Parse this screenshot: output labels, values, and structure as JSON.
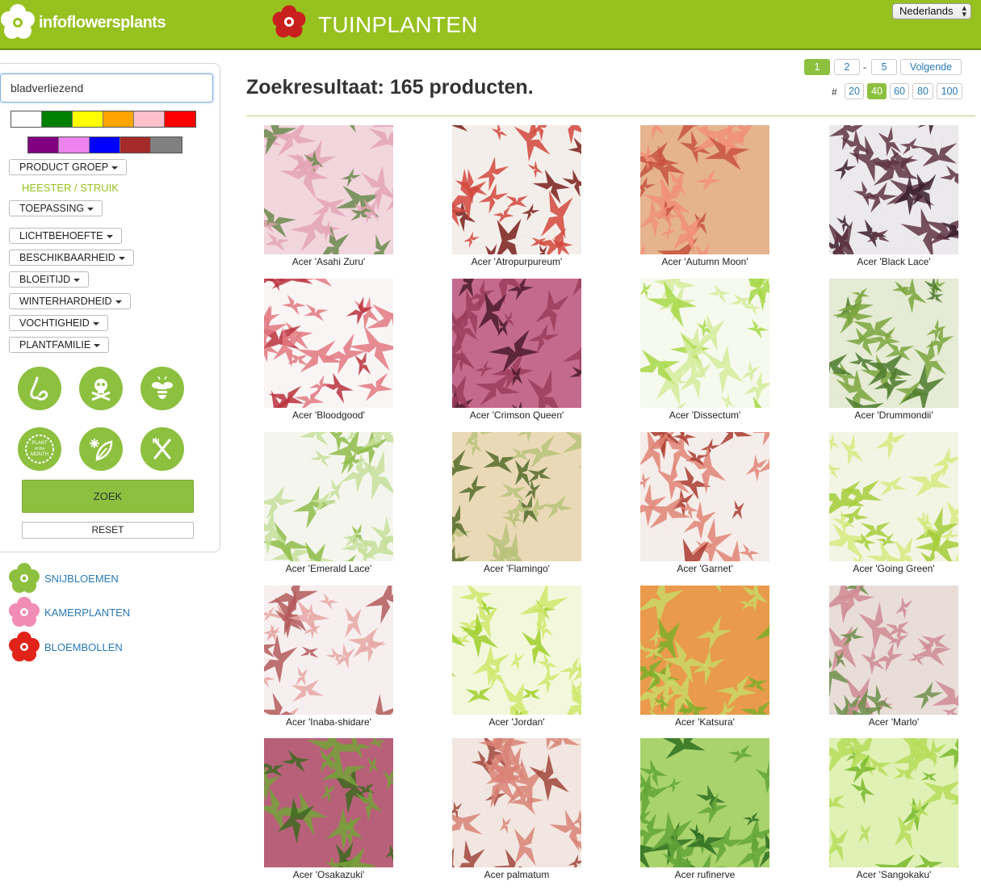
{
  "header": {
    "logo_text": "infoflowersplants",
    "category_title": "TUINPLANTEN",
    "language": "Nederlands"
  },
  "sidebar": {
    "search_value": "bladverliezend",
    "colors_row1": [
      "#ffffff",
      "#008000",
      "#ffff00",
      "#ffa500",
      "#ffc0cb",
      "#ff0000"
    ],
    "colors_row2": [
      "#800080",
      "#ee82ee",
      "#0000ff",
      "#a52a2a",
      "#808080"
    ],
    "filters": {
      "product_groep": "PRODUCT GROEP",
      "selected_groep": "HEESTER / STRUIK",
      "toepassing": "TOEPASSING",
      "lichtbehoefte": "LICHTBEHOEFTE",
      "beschikbaarheid": "BESCHIKBAARHEID",
      "bloeitijd": "BLOEITIJD",
      "winterhardheid": "WINTERHARDHEID",
      "vochtigheid": "VOCHTIGHEID",
      "plantfamilie": "PLANTFAMILIE"
    },
    "icon_buttons": [
      "scent-icon",
      "poison-skull-icon",
      "bee-icon",
      "plant-of-the-month-icon",
      "frost-leaf-icon",
      "edible-fork-knife-icon"
    ],
    "plant_month_text": [
      "PLANT",
      "of the",
      "MONTH"
    ],
    "zoek_label": "ZOEK",
    "reset_label": "RESET"
  },
  "categories": [
    {
      "label": "SNIJBLOEMEN",
      "color": "#8dc03f"
    },
    {
      "label": "KAMERPLANTEN",
      "color": "#f08cb5"
    },
    {
      "label": "BLOEMBOLLEN",
      "color": "#e2231a"
    }
  ],
  "results": {
    "title": "Zoekresultaat: 165 producten.",
    "pagination": {
      "current": "1",
      "next_page": "2",
      "separator": "-",
      "last": "5",
      "next_label": "Volgende"
    },
    "per_page": {
      "hash": "#",
      "options": [
        "20",
        "40",
        "60",
        "80",
        "100"
      ],
      "selected": "40"
    }
  },
  "products": [
    {
      "name": "Acer 'Asahi Zuru'",
      "colors": [
        "#6b8a4e",
        "#e4a5b6",
        "#f2d6de"
      ]
    },
    {
      "name": "Acer 'Atropurpureum'",
      "colors": [
        "#7a1f1c",
        "#d2473c",
        "#f4eeea"
      ]
    },
    {
      "name": "Acer 'Autumn Moon'",
      "colors": [
        "#c8543f",
        "#f1917a",
        "#e5b48f"
      ]
    },
    {
      "name": "Acer 'Black Lace'",
      "colors": [
        "#3a1e2c",
        "#5f3443",
        "#ece9ec"
      ]
    },
    {
      "name": "Acer 'Bloodgood'",
      "colors": [
        "#b8313d",
        "#e27880",
        "#faf5f5"
      ]
    },
    {
      "name": "Acer 'Crimson Queen'",
      "colors": [
        "#4b1a2a",
        "#9b3c5b",
        "#c46a8c"
      ]
    },
    {
      "name": "Acer 'Dissectum'",
      "colors": [
        "#a7d845",
        "#d3ec9a",
        "#f6f9ee"
      ]
    },
    {
      "name": "Acer 'Drummondii'",
      "colors": [
        "#4d7a2b",
        "#7ba63d",
        "#e5ebd4"
      ]
    },
    {
      "name": "Acer 'Emerald Lace'",
      "colors": [
        "#8fbc4a",
        "#c6df9a",
        "#f4f6ee"
      ]
    },
    {
      "name": "Acer 'Flamingo'",
      "colors": [
        "#536b2b",
        "#b8c27a",
        "#ead9b6"
      ]
    },
    {
      "name": "Acer 'Garnet'",
      "colors": [
        "#a93a2f",
        "#e08476",
        "#f5ede9"
      ]
    },
    {
      "name": "Acer 'Going Green'",
      "colors": [
        "#a6cc3a",
        "#d6ea7e",
        "#f2f5e3"
      ]
    },
    {
      "name": "Acer 'Inaba-shidare'",
      "colors": [
        "#b45b5c",
        "#e6a7a4",
        "#f7efef"
      ]
    },
    {
      "name": "Acer 'Jordan'",
      "colors": [
        "#9fcf2a",
        "#cfe86b",
        "#f3f8dc"
      ]
    },
    {
      "name": "Acer 'Katsura'",
      "colors": [
        "#7fae2a",
        "#c9d866",
        "#e99a4c"
      ]
    },
    {
      "name": "Acer 'Marlo'",
      "colors": [
        "#6d8f4b",
        "#cf8b93",
        "#e9ddd8"
      ]
    },
    {
      "name": "Acer 'Osakazuki'",
      "colors": [
        "#3d6820",
        "#74a23a",
        "#b8607a"
      ]
    },
    {
      "name": "Acer palmatum",
      "colors": [
        "#a1453b",
        "#d98376",
        "#f2e6e0"
      ]
    },
    {
      "name": "Acer rufinerve",
      "colors": [
        "#2f6e20",
        "#63a538",
        "#a9d36d"
      ]
    },
    {
      "name": "Acer 'Sangokaku'",
      "colors": [
        "#79b82c",
        "#b5dd59",
        "#e0f1b5"
      ]
    }
  ]
}
